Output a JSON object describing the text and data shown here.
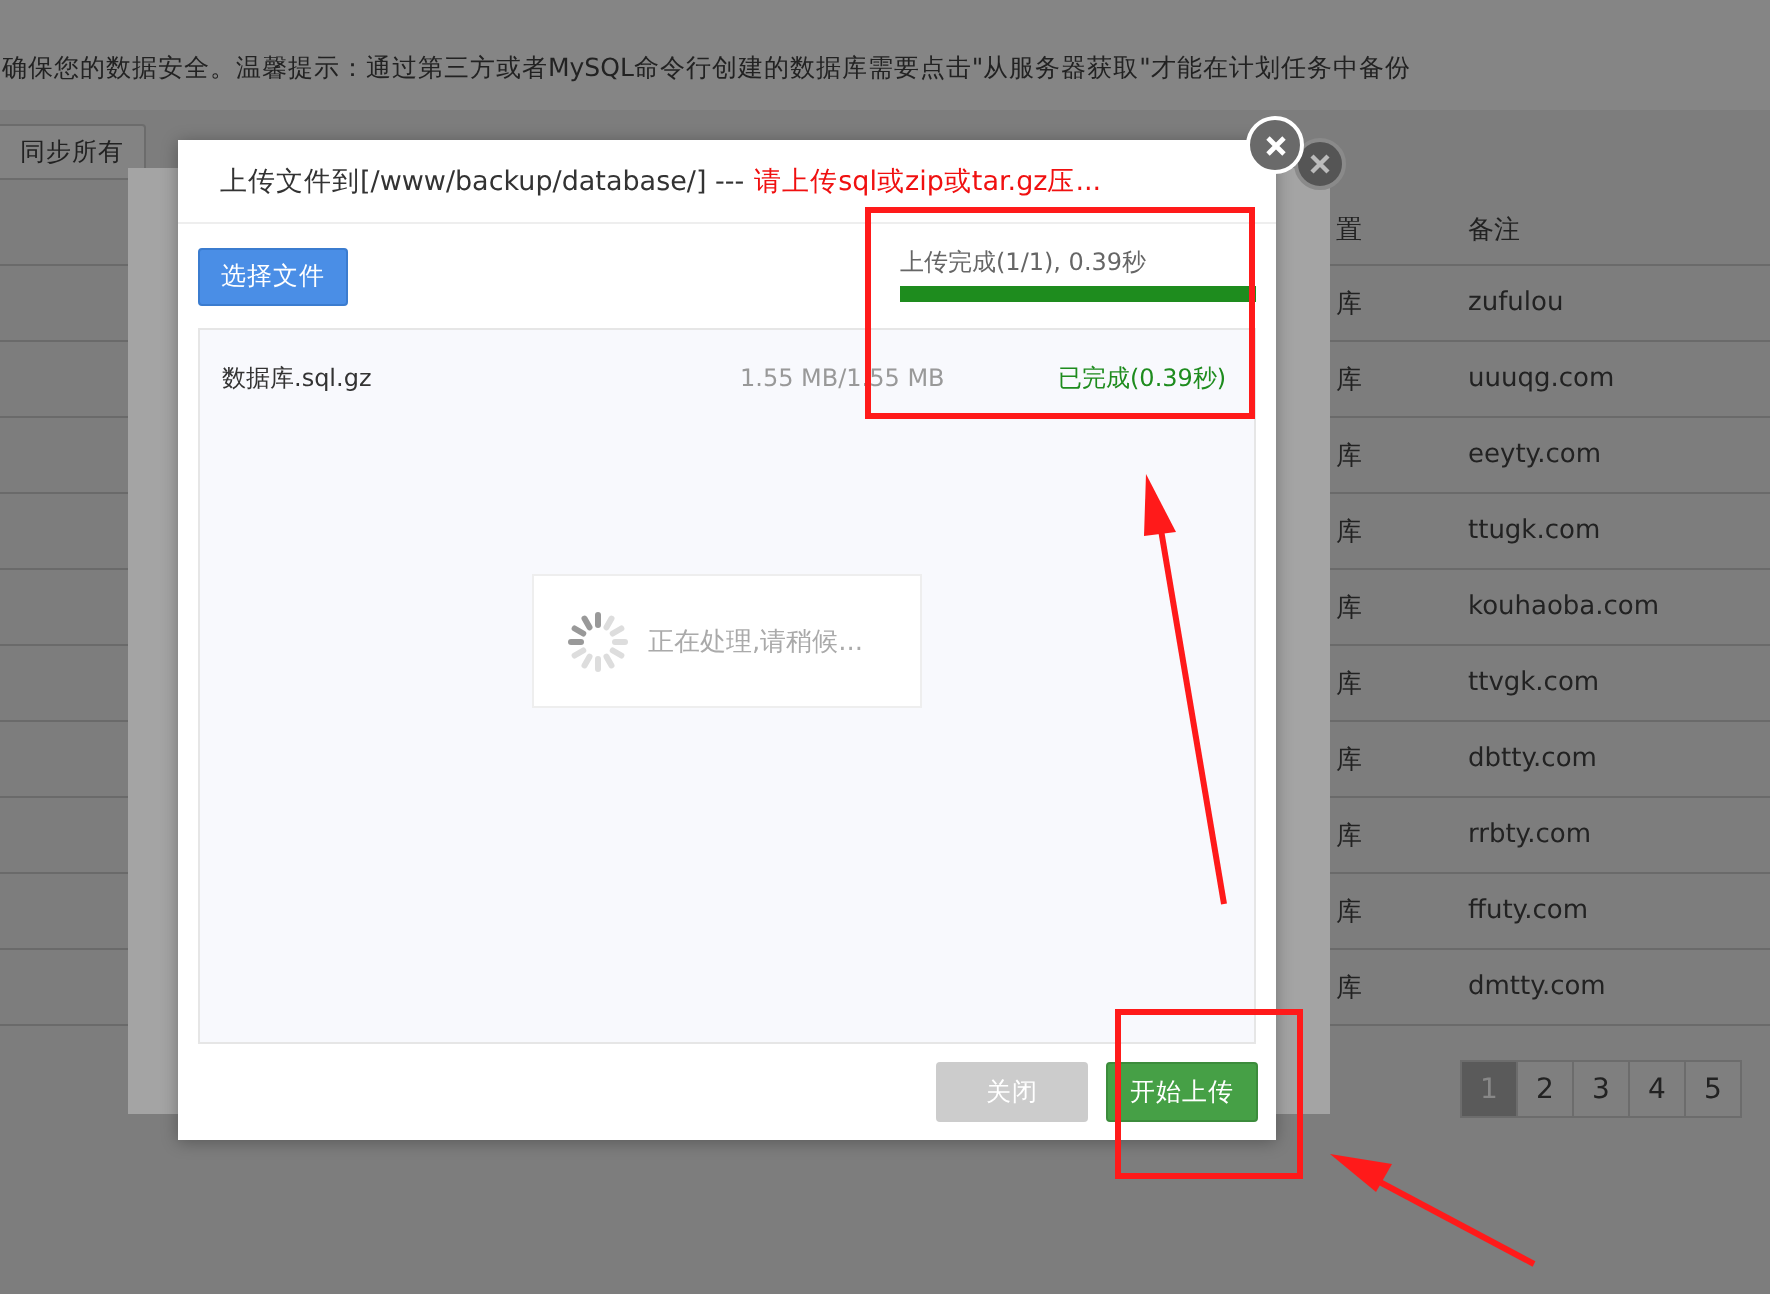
{
  "notice": "确保您的数据安全。温馨提示：通过第三方或者MySQL命令行创建的数据库需要点击\"从服务器获取\"才能在计划任务中备份",
  "toolbar": [
    "同步所有"
  ],
  "table": {
    "columns": [
      "置",
      "备注"
    ],
    "rows": [
      {
        "column_1": "库",
        "remark": "zufulou"
      },
      {
        "column_1": "库",
        "remark": "uuuqg.com"
      },
      {
        "column_1": "库",
        "remark": "eeyty.com"
      },
      {
        "column_1": "库",
        "remark": "ttugk.com"
      },
      {
        "column_1": "库",
        "remark": "kouhaoba.com"
      },
      {
        "column_1": "库",
        "remark": "ttvgk.com"
      },
      {
        "column_1": "库",
        "remark": "dbtty.com"
      },
      {
        "column_1": "库",
        "remark": "rrbty.com"
      },
      {
        "column_1": "库",
        "remark": "ffuty.com"
      },
      {
        "column_1": "库",
        "remark": "dmtty.com"
      }
    ]
  },
  "pagination": [
    {
      "label": "1",
      "selected": true
    },
    {
      "label": "2",
      "selected": false
    },
    {
      "label": "3",
      "selected": false
    },
    {
      "label": "4",
      "selected": false
    },
    {
      "label": "5",
      "selected": false
    }
  ],
  "upload_dialog": {
    "title": "上传文件到[/www/backup/database/] ---",
    "title_hint": "请上传sql或zip或tar.gz压...",
    "choose_button": "选择文件",
    "progress_text": "上传完成(1/1), 0.39秒",
    "progress": {
      "level": 1
    },
    "files": [
      {
        "name": "数据库.sql.gz",
        "size": "1.55 MB/1.55 MB",
        "status": "已完成(0.39秒)",
        "done": true
      }
    ],
    "loading_text": "正在处理,请稍候...",
    "buttons": [
      {
        "label": "关闭",
        "kind": "close",
        "disabled": true
      },
      {
        "label": "开始上传",
        "kind": "primary",
        "disabled": false
      }
    ]
  }
}
